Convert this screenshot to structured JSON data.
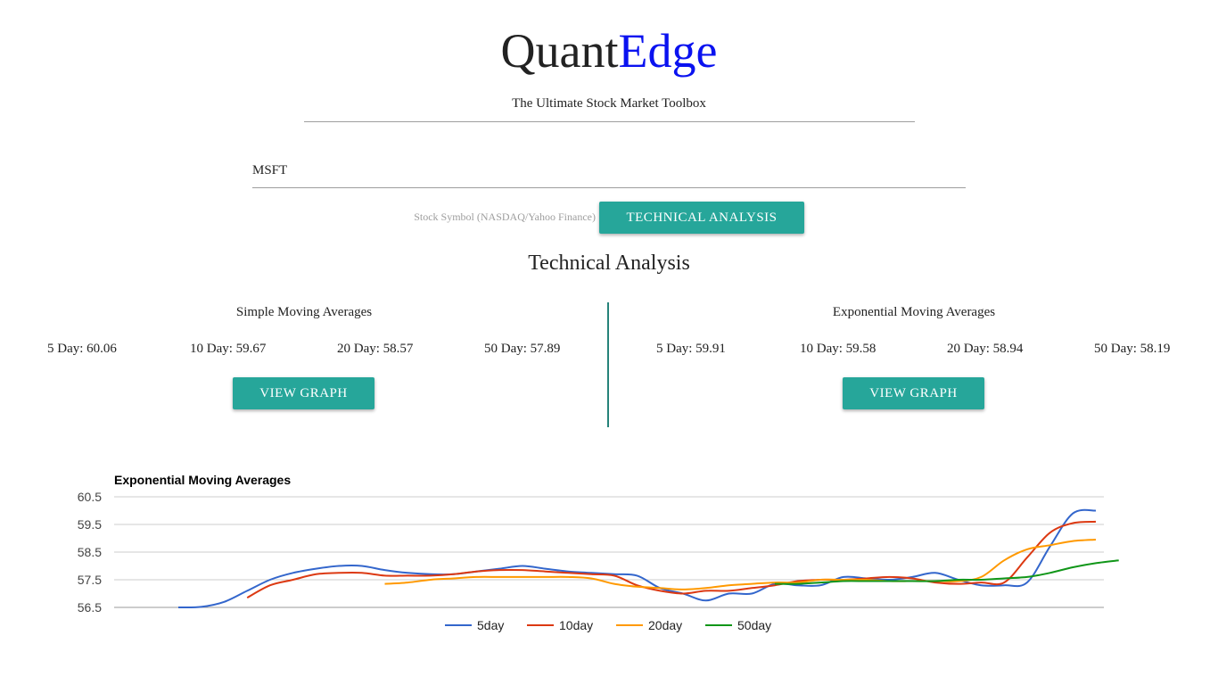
{
  "header": {
    "brand_part1": "Quant",
    "brand_part2": "Edge",
    "tagline": "The Ultimate Stock Market Toolbox"
  },
  "search": {
    "value": "MSFT",
    "label": "Stock Symbol (NASDAQ/Yahoo Finance)",
    "button_label": "TECHNICAL ANALYSIS"
  },
  "analysis": {
    "title": "Technical Analysis",
    "sma": {
      "title": "Simple Moving Averages",
      "items": [
        "5 Day: 60.06",
        "10 Day: 59.67",
        "20 Day: 58.57",
        "50 Day: 57.89"
      ],
      "button_label": "VIEW GRAPH"
    },
    "ema": {
      "title": "Exponential Moving Averages",
      "items": [
        "5 Day: 59.91",
        "10 Day: 59.58",
        "20 Day: 58.94",
        "50 Day: 58.19"
      ],
      "button_label": "VIEW GRAPH"
    }
  },
  "colors": {
    "accent": "#26a69a",
    "divider": "#26837a",
    "brand_blue": "#0a12f0"
  },
  "chart_data": {
    "type": "line",
    "title": "Exponential Moving Averages",
    "xlabel": "",
    "ylabel": "",
    "ylim": [
      56.5,
      60.5
    ],
    "yticks": [
      "60.5",
      "59.5",
      "58.5",
      "57.5",
      "56.5"
    ],
    "grid": true,
    "legend_position": "bottom",
    "n_points": 41,
    "series": [
      {
        "name": "5day",
        "color": "#3366cc",
        "start_index": 0,
        "values": [
          56.5,
          56.52,
          56.7,
          57.1,
          57.5,
          57.75,
          57.9,
          58.0,
          58.0,
          57.85,
          57.75,
          57.7,
          57.7,
          57.8,
          57.9,
          58.0,
          57.9,
          57.8,
          57.75,
          57.7,
          57.65,
          57.2,
          57.0,
          56.75,
          57.0,
          57.0,
          57.35,
          57.3,
          57.3,
          57.6,
          57.55,
          57.5,
          57.6,
          57.75,
          57.5,
          57.3,
          57.3,
          57.4,
          58.7,
          59.9,
          60.0
        ]
      },
      {
        "name": "10day",
        "color": "#dc3912",
        "start_index": 3,
        "values": [
          56.85,
          57.3,
          57.5,
          57.7,
          57.75,
          57.75,
          57.65,
          57.65,
          57.65,
          57.7,
          57.8,
          57.85,
          57.85,
          57.8,
          57.75,
          57.7,
          57.65,
          57.3,
          57.1,
          57.0,
          57.1,
          57.1,
          57.2,
          57.3,
          57.45,
          57.5,
          57.5,
          57.55,
          57.6,
          57.55,
          57.4,
          57.35,
          57.4,
          57.4,
          58.3,
          59.2,
          59.55,
          59.6
        ]
      },
      {
        "name": "20day",
        "color": "#ff9900",
        "start_index": 9,
        "values": [
          57.35,
          57.4,
          57.5,
          57.55,
          57.6,
          57.6,
          57.6,
          57.6,
          57.6,
          57.55,
          57.35,
          57.25,
          57.2,
          57.15,
          57.2,
          57.3,
          57.35,
          57.4,
          57.4,
          57.5,
          57.5,
          57.5,
          57.45,
          57.45,
          57.45,
          57.45,
          57.6,
          58.2,
          58.6,
          58.75,
          58.9,
          58.95
        ]
      },
      {
        "name": "50day",
        "color": "#109618",
        "start_index": 26,
        "values": [
          57.35,
          57.35,
          57.4,
          57.45,
          57.45,
          57.45,
          57.45,
          57.45,
          57.5,
          57.5,
          57.55,
          57.6,
          57.75,
          57.95,
          58.1,
          58.2
        ]
      }
    ]
  }
}
